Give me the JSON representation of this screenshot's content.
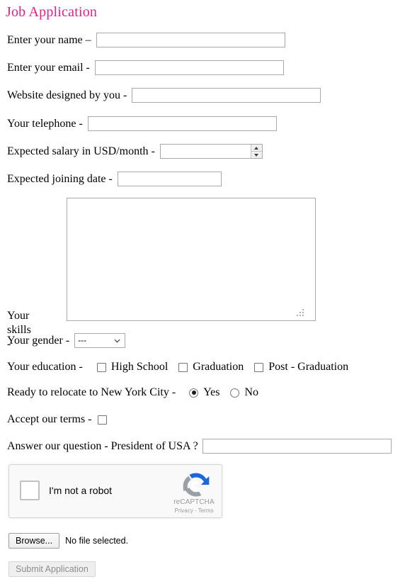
{
  "page": {
    "title": "Job Application",
    "title_color": "#e0218a",
    "background": "#ffffff"
  },
  "fields": {
    "name": {
      "label": "Enter your name –",
      "value": "",
      "placeholder": ""
    },
    "email": {
      "label": "Enter your email -",
      "value": "",
      "placeholder": ""
    },
    "website": {
      "label": "Website designed by you -",
      "value": "",
      "placeholder": ""
    },
    "telephone": {
      "label": "Your telephone -",
      "value": "",
      "placeholder": ""
    },
    "salary": {
      "label": "Expected salary in USD/month -",
      "value": "",
      "placeholder": "",
      "spinner_up": "increment-arrow",
      "spinner_down": "decrement-arrow"
    },
    "joining_date": {
      "label": "Expected joining date -",
      "value": "",
      "placeholder": ""
    },
    "skills": {
      "label": "Your skills -",
      "value": "",
      "placeholder": ""
    },
    "gender": {
      "label": "Your gender -",
      "selected": "---",
      "options": [
        "---"
      ]
    },
    "education": {
      "label": "Your education -",
      "options": [
        {
          "label": "High School",
          "checked": false
        },
        {
          "label": "Graduation",
          "checked": false
        },
        {
          "label": "Post - Graduation",
          "checked": false
        }
      ]
    },
    "relocate": {
      "label": "Ready to relocate to New York City -",
      "options": [
        {
          "label": "Yes",
          "checked": true
        },
        {
          "label": "No",
          "checked": false
        }
      ]
    },
    "terms": {
      "label": "Accept our terms -",
      "checked": false
    },
    "question": {
      "label": "Answer our question - President of USA ?",
      "value": "",
      "placeholder": ""
    }
  },
  "recaptcha": {
    "checkbox_label": "I'm not a robot",
    "brand": "reCAPTCHA",
    "legal": "Privacy - Terms",
    "checked": false,
    "logo_blue": "#1c68d8",
    "logo_gray": "#9aa0a6"
  },
  "file_upload": {
    "button_label": "Browse...",
    "status": "No file selected."
  },
  "submit": {
    "label": "Submit Application",
    "disabled": true
  }
}
